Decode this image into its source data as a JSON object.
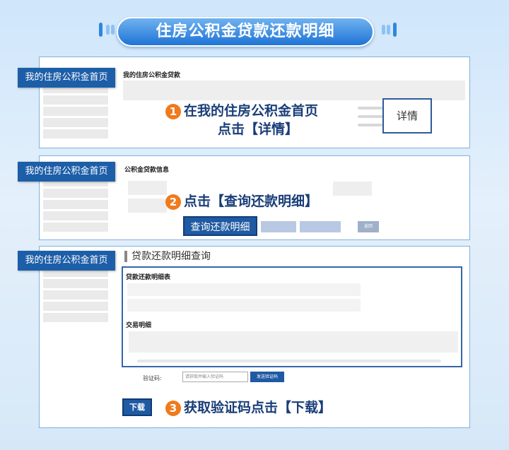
{
  "title": "住房公积金贷款还款明细",
  "steps": {
    "step1_num": "1",
    "step1_line1": "在我的住房公积金首页",
    "step1_line2": "点击【详情】",
    "step2_num": "2",
    "step2_text": "点击【查询还款明细】",
    "step3_num": "3",
    "step3_text": "获取验证码点击【下载】"
  },
  "panel1": {
    "home_tag": "我的住房公积金首页",
    "section_title": "我的住房公积金贷款",
    "detail_button": "详情"
  },
  "panel2": {
    "home_tag": "我的住房公积金首页",
    "section_title": "公积金贷款信息",
    "query_button": "查询还款明细",
    "return_button": "返回"
  },
  "panel3": {
    "home_tag": "我的住房公积金首页",
    "header": "贷款还款明细查询",
    "table_title": "贷款还款明细表",
    "transaction_title": "交易明细",
    "verify_label": "验证码:",
    "verify_placeholder": "请获取并输入验证码",
    "send_code_button": "发送验证码",
    "download_button": "下载"
  },
  "colors": {
    "accent": "#1f5aa3",
    "step_badge": "#f07a1c",
    "step_text": "#1a3e78"
  }
}
